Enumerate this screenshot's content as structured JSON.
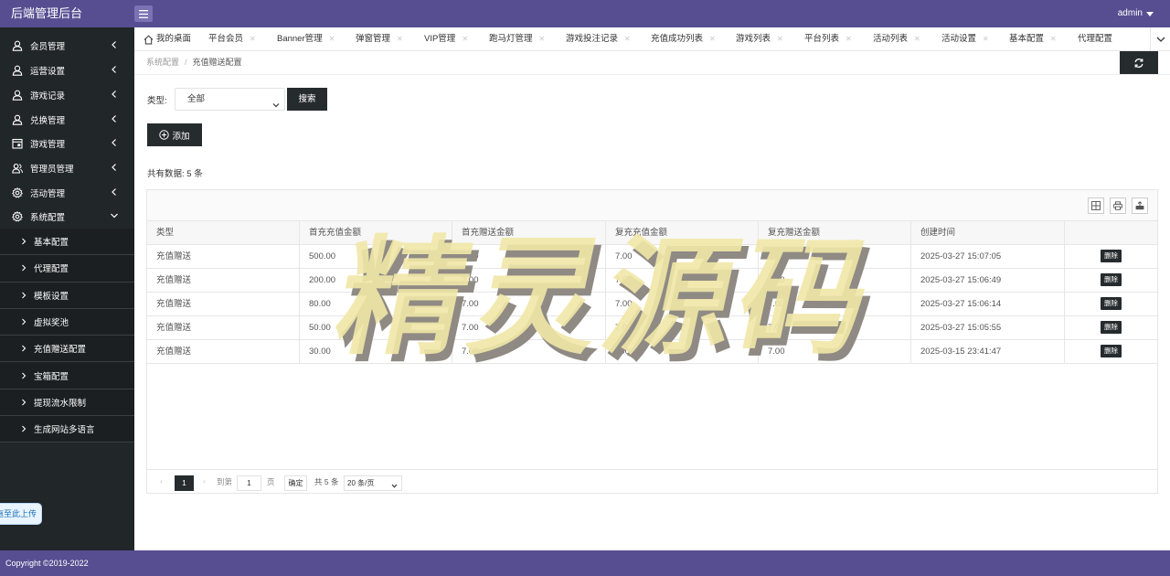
{
  "app": {
    "title": "后端管理后台",
    "user": "admin"
  },
  "sidebar": {
    "items": [
      {
        "label": "会员管理",
        "icon": "user-icon"
      },
      {
        "label": "运营设置",
        "icon": "user-icon"
      },
      {
        "label": "游戏记录",
        "icon": "user-icon"
      },
      {
        "label": "兑换管理",
        "icon": "user-icon"
      },
      {
        "label": "游戏管理",
        "icon": "calendar-icon"
      },
      {
        "label": "管理员管理",
        "icon": "users-icon"
      },
      {
        "label": "活动管理",
        "icon": "gear-icon"
      },
      {
        "label": "系统配置",
        "icon": "gear-icon"
      }
    ],
    "sub_items": [
      {
        "label": "基本配置"
      },
      {
        "label": "代理配置"
      },
      {
        "label": "模板设置"
      },
      {
        "label": "虚拟奖池"
      },
      {
        "label": "充值赠送配置"
      },
      {
        "label": "宝箱配置"
      },
      {
        "label": "提现流水限制"
      },
      {
        "label": "生成网站多语言"
      }
    ],
    "upload_label": "拖至此上传"
  },
  "tabs": [
    {
      "label": "我的桌面"
    },
    {
      "label": "平台会员"
    },
    {
      "label": "Banner管理"
    },
    {
      "label": "弹窗管理"
    },
    {
      "label": "VIP管理"
    },
    {
      "label": "跑马灯管理"
    },
    {
      "label": "游戏投注记录"
    },
    {
      "label": "充值成功列表"
    },
    {
      "label": "游戏列表"
    },
    {
      "label": "平台列表"
    },
    {
      "label": "活动列表"
    },
    {
      "label": "活动设置"
    },
    {
      "label": "基本配置"
    },
    {
      "label": "代理配置"
    }
  ],
  "breadcrumb": {
    "parent": "系统配置",
    "separator": "/",
    "current": "充值赠送配置"
  },
  "filter": {
    "label": "类型:",
    "select_value": "全部",
    "search_label": "搜索"
  },
  "add_label": "添加",
  "count_text": "共有数据: 5 条",
  "table": {
    "headers": [
      "类型",
      "首充充值金额",
      "首充赠送金额",
      "复充充值金额",
      "复充赠送金额",
      "创建时间",
      ""
    ],
    "delete_label": "删除",
    "rows": [
      [
        "充值赠送",
        "500.00",
        "7.00",
        "7.00",
        "7.00",
        "2025-03-27 15:07:05"
      ],
      [
        "充值赠送",
        "200.00",
        "7.00",
        "7.00",
        "7.00",
        "2025-03-27 15:06:49"
      ],
      [
        "充值赠送",
        "80.00",
        "7.00",
        "7.00",
        "7.00",
        "2025-03-27 15:06:14"
      ],
      [
        "充值赠送",
        "50.00",
        "7.00",
        "7.00",
        "7.00",
        "2025-03-27 15:05:55"
      ],
      [
        "充值赠送",
        "30.00",
        "7.00",
        "100.00",
        "7.00",
        "2025-03-15 23:41:47"
      ]
    ]
  },
  "pager": {
    "prev": "‹",
    "current_page": "1",
    "next": "›",
    "goto_label": "到第",
    "goto_value": "1",
    "page_unit": "页",
    "confirm_label": "确定",
    "total_label": "共 5 条",
    "size_label": "20 条/页"
  },
  "watermark_text": "精灵源码",
  "footer": {
    "copyright": "Copyright ©2019-2022"
  },
  "colors": {
    "header_bg": "#574e91",
    "sidebar_bg": "#212629",
    "button_bg": "#262b2e",
    "watermark": "#f1e7a7"
  }
}
